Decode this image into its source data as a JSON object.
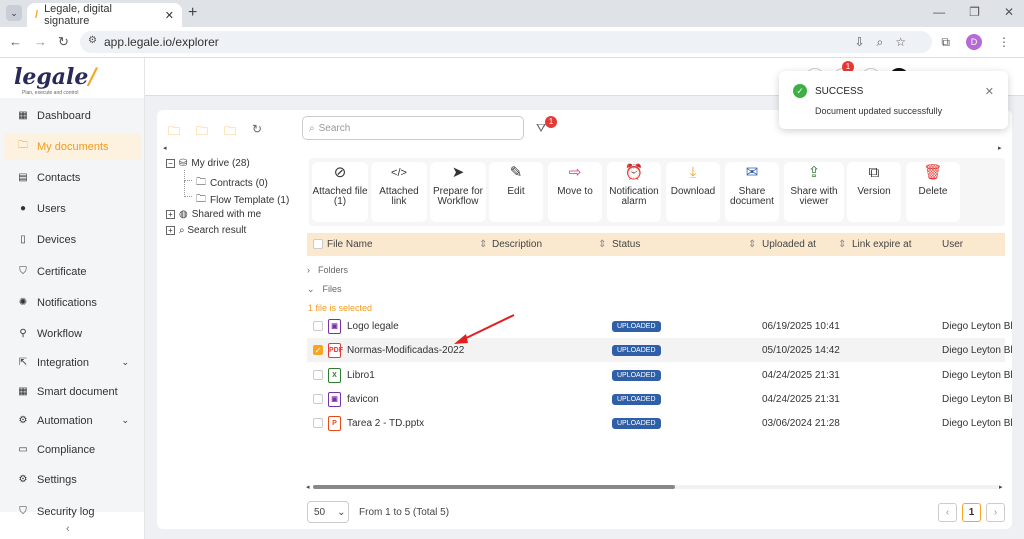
{
  "browser": {
    "tab_title": "Legale, digital signature",
    "url": "app.legale.io/explorer",
    "profile_initial": "D"
  },
  "logo": {
    "text": "legale",
    "tagline": "Plan, execute and control"
  },
  "sidebar": {
    "items": [
      {
        "label": "Dashboard",
        "icon": "dashboard-icon"
      },
      {
        "label": "My documents",
        "icon": "folder-icon",
        "active": true
      },
      {
        "label": "Contacts",
        "icon": "contacts-icon"
      },
      {
        "label": "Users",
        "icon": "user-icon"
      },
      {
        "label": "Devices",
        "icon": "device-icon"
      },
      {
        "label": "Certificate",
        "icon": "shield-icon"
      },
      {
        "label": "Notifications",
        "icon": "bell-icon"
      },
      {
        "label": "Workflow",
        "icon": "workflow-icon"
      },
      {
        "label": "Integration",
        "icon": "external-link-icon",
        "expandable": true
      },
      {
        "label": "Smart document",
        "icon": "table-icon"
      },
      {
        "label": "Automation",
        "icon": "gear-icon",
        "expandable": true
      },
      {
        "label": "Compliance",
        "icon": "chat-icon"
      },
      {
        "label": "Settings",
        "icon": "settings-icon"
      },
      {
        "label": "Security log",
        "icon": "shield-icon"
      }
    ]
  },
  "header": {
    "notification_count": "1"
  },
  "toast": {
    "title": "SUCCESS",
    "message": "Document updated successfully"
  },
  "explorer": {
    "search_placeholder": "Search",
    "filter_count": "1",
    "tree": {
      "my_drive": "My drive (28)",
      "contracts": "Contracts (0)",
      "flow_template": "Flow Template (1)",
      "shared": "Shared with me",
      "search_result": "Search result"
    },
    "actions": [
      {
        "label": "Attached file (1)",
        "icon": "paperclip-icon"
      },
      {
        "label": "Attached link",
        "icon": "code-icon"
      },
      {
        "label": "Prepare for Workflow",
        "icon": "send-icon"
      },
      {
        "label": "Edit",
        "icon": "edit-icon"
      },
      {
        "label": "Move to",
        "icon": "move-icon"
      },
      {
        "label": "Notification alarm",
        "icon": "alarm-icon"
      },
      {
        "label": "Download",
        "icon": "download-icon"
      },
      {
        "label": "Share document",
        "icon": "mail-icon"
      },
      {
        "label": "Share with viewer",
        "icon": "share-viewer-icon"
      },
      {
        "label": "Version",
        "icon": "version-icon"
      },
      {
        "label": "Delete",
        "icon": "trash-icon"
      }
    ],
    "columns": [
      "File Name",
      "Description",
      "Status",
      "Uploaded at",
      "Link expire at",
      "User"
    ],
    "folders_label": "Folders",
    "files_label": "Files",
    "selection_info": "1 file is selected",
    "rows": [
      {
        "name": "Logo legale",
        "type": "img",
        "status": "UPLOADED",
        "uploaded": "06/19/2025 10:41",
        "user": "Diego Leyton Bl",
        "checked": false
      },
      {
        "name": "Normas-Modificadas-2022",
        "type": "pdf",
        "status": "UPLOADED",
        "uploaded": "05/10/2025 14:42",
        "user": "Diego Leyton Bl",
        "checked": true
      },
      {
        "name": "Libro1",
        "type": "xls",
        "status": "UPLOADED",
        "uploaded": "04/24/2025 21:31",
        "user": "Diego Leyton Bl",
        "checked": false
      },
      {
        "name": "favicon",
        "type": "img",
        "status": "UPLOADED",
        "uploaded": "04/24/2025 21:31",
        "user": "Diego Leyton Bl",
        "checked": false
      },
      {
        "name": "Tarea 2 - TD.pptx",
        "type": "ppt",
        "status": "UPLOADED",
        "uploaded": "03/06/2024 21:28",
        "user": "Diego Leyton Bl",
        "checked": false
      }
    ],
    "page_size": "50",
    "range_text": "From 1 to 5 (Total 5)",
    "current_page": "1"
  },
  "colors": {
    "accent": "#f5a623",
    "status": "#2f5fa7",
    "success": "#3cb043",
    "badge": "#e53935"
  }
}
